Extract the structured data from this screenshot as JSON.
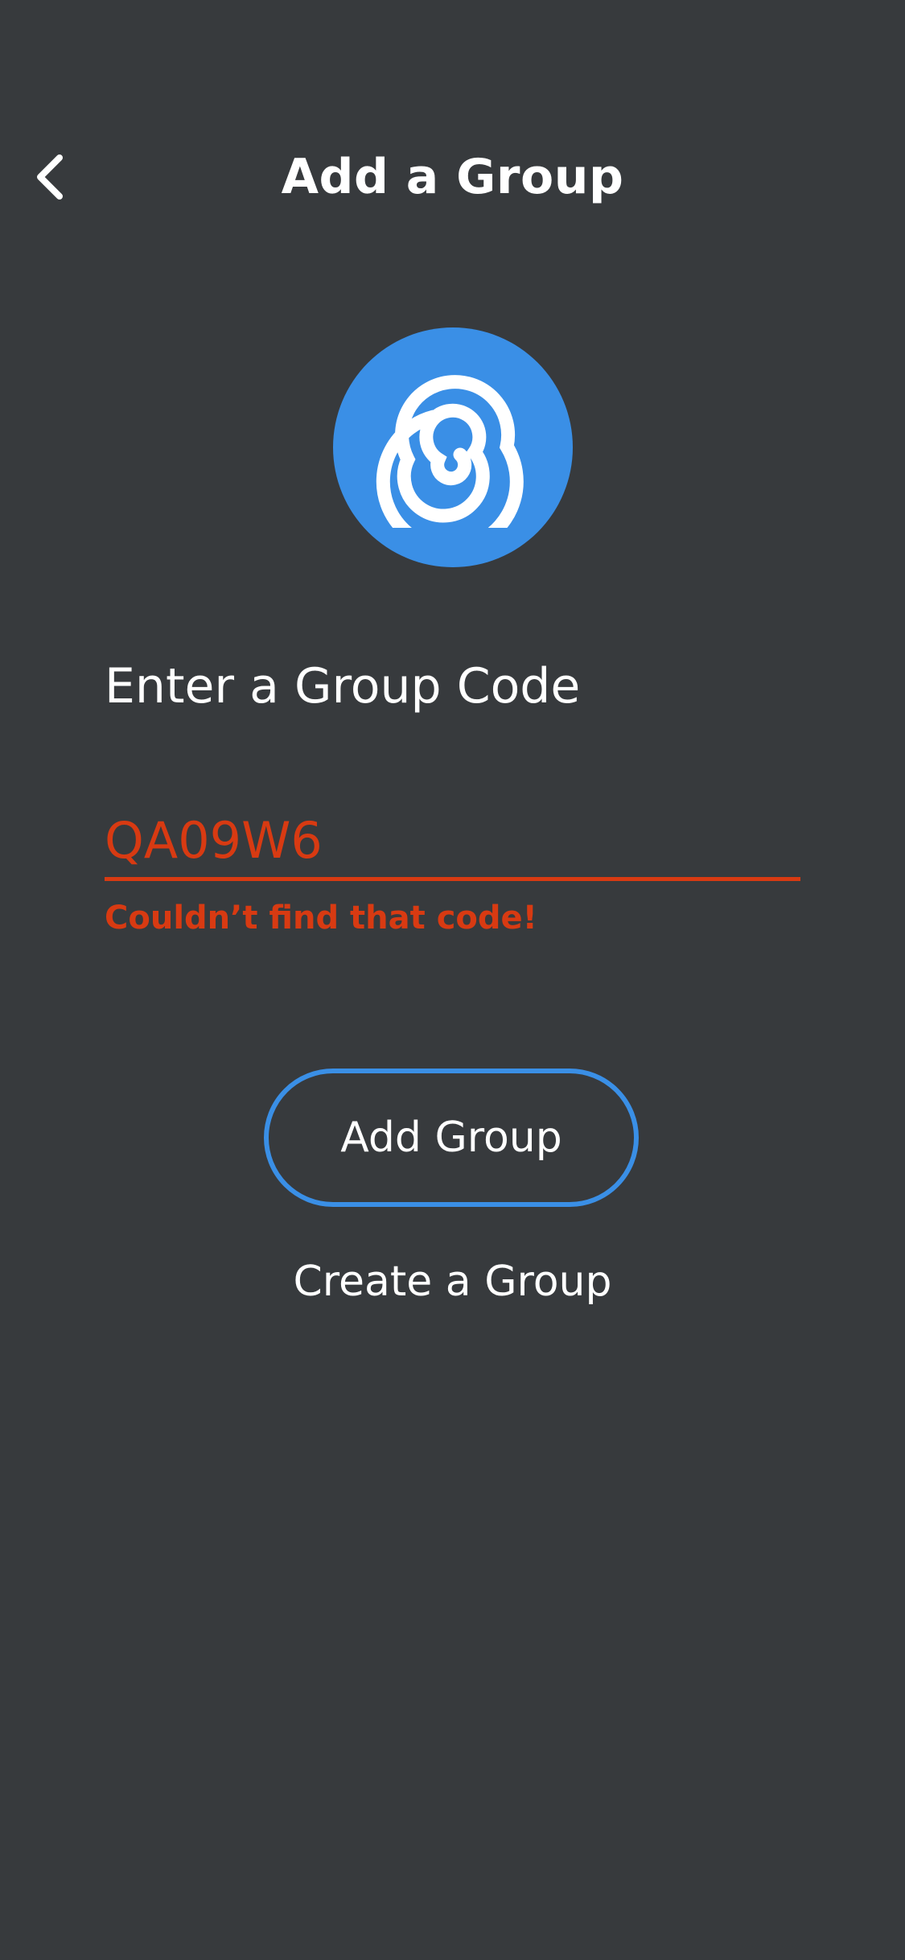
{
  "header": {
    "title": "Add a Group",
    "back_icon": "chevron-left-icon"
  },
  "logo": {
    "icon": "spiral-icon",
    "color": "#3a8fe6"
  },
  "form": {
    "prompt": "Enter a Group Code",
    "code_value": "QA09W6",
    "error": "Couldn’t find that code!",
    "error_color": "#d83a12"
  },
  "actions": {
    "add_label": "Add Group",
    "create_label": "Create a Group"
  },
  "theme": {
    "background": "#373a3d",
    "accent": "#3a8fe6"
  }
}
